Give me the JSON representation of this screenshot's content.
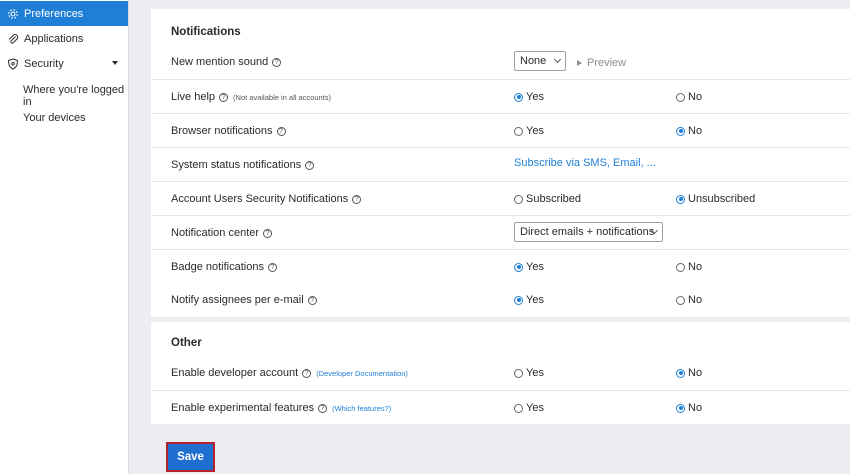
{
  "sidebar": {
    "items": [
      {
        "label": "Preferences",
        "icon": "gear-icon"
      },
      {
        "label": "Applications",
        "icon": "paperclip-icon"
      },
      {
        "label": "Security",
        "icon": "shield-icon"
      }
    ],
    "security_sub": [
      {
        "label": "Where you're logged in"
      },
      {
        "label": "Your devices"
      }
    ]
  },
  "notifications": {
    "title": "Notifications",
    "mention_sound": {
      "label": "New mention sound",
      "value": "None",
      "preview": "Preview"
    },
    "live_help": {
      "label": "Live help",
      "note": "(Not available in all accounts)",
      "opt1": "Yes",
      "opt2": "No"
    },
    "browser": {
      "label": "Browser notifications",
      "opt1": "Yes",
      "opt2": "No"
    },
    "system_status": {
      "label": "System status notifications",
      "link": "Subscribe via SMS, Email, ..."
    },
    "security_notif": {
      "label": "Account Users Security Notifications",
      "opt1": "Subscribed",
      "opt2": "Unsubscribed"
    },
    "center": {
      "label": "Notification center",
      "value": "Direct emails + notifications"
    },
    "badge": {
      "label": "Badge notifications",
      "opt1": "Yes",
      "opt2": "No"
    },
    "assignees": {
      "label": "Notify assignees per e-mail",
      "opt1": "Yes",
      "opt2": "No"
    }
  },
  "other": {
    "title": "Other",
    "developer": {
      "label": "Enable developer account",
      "link": "(Developer Documentation)",
      "opt1": "Yes",
      "opt2": "No"
    },
    "experimental": {
      "label": "Enable experimental features",
      "link": "(Which features?)",
      "opt1": "Yes",
      "opt2": "No"
    }
  },
  "save_label": "Save",
  "colors": {
    "accent": "#1f7fd6",
    "save_border": "#b3222b"
  }
}
